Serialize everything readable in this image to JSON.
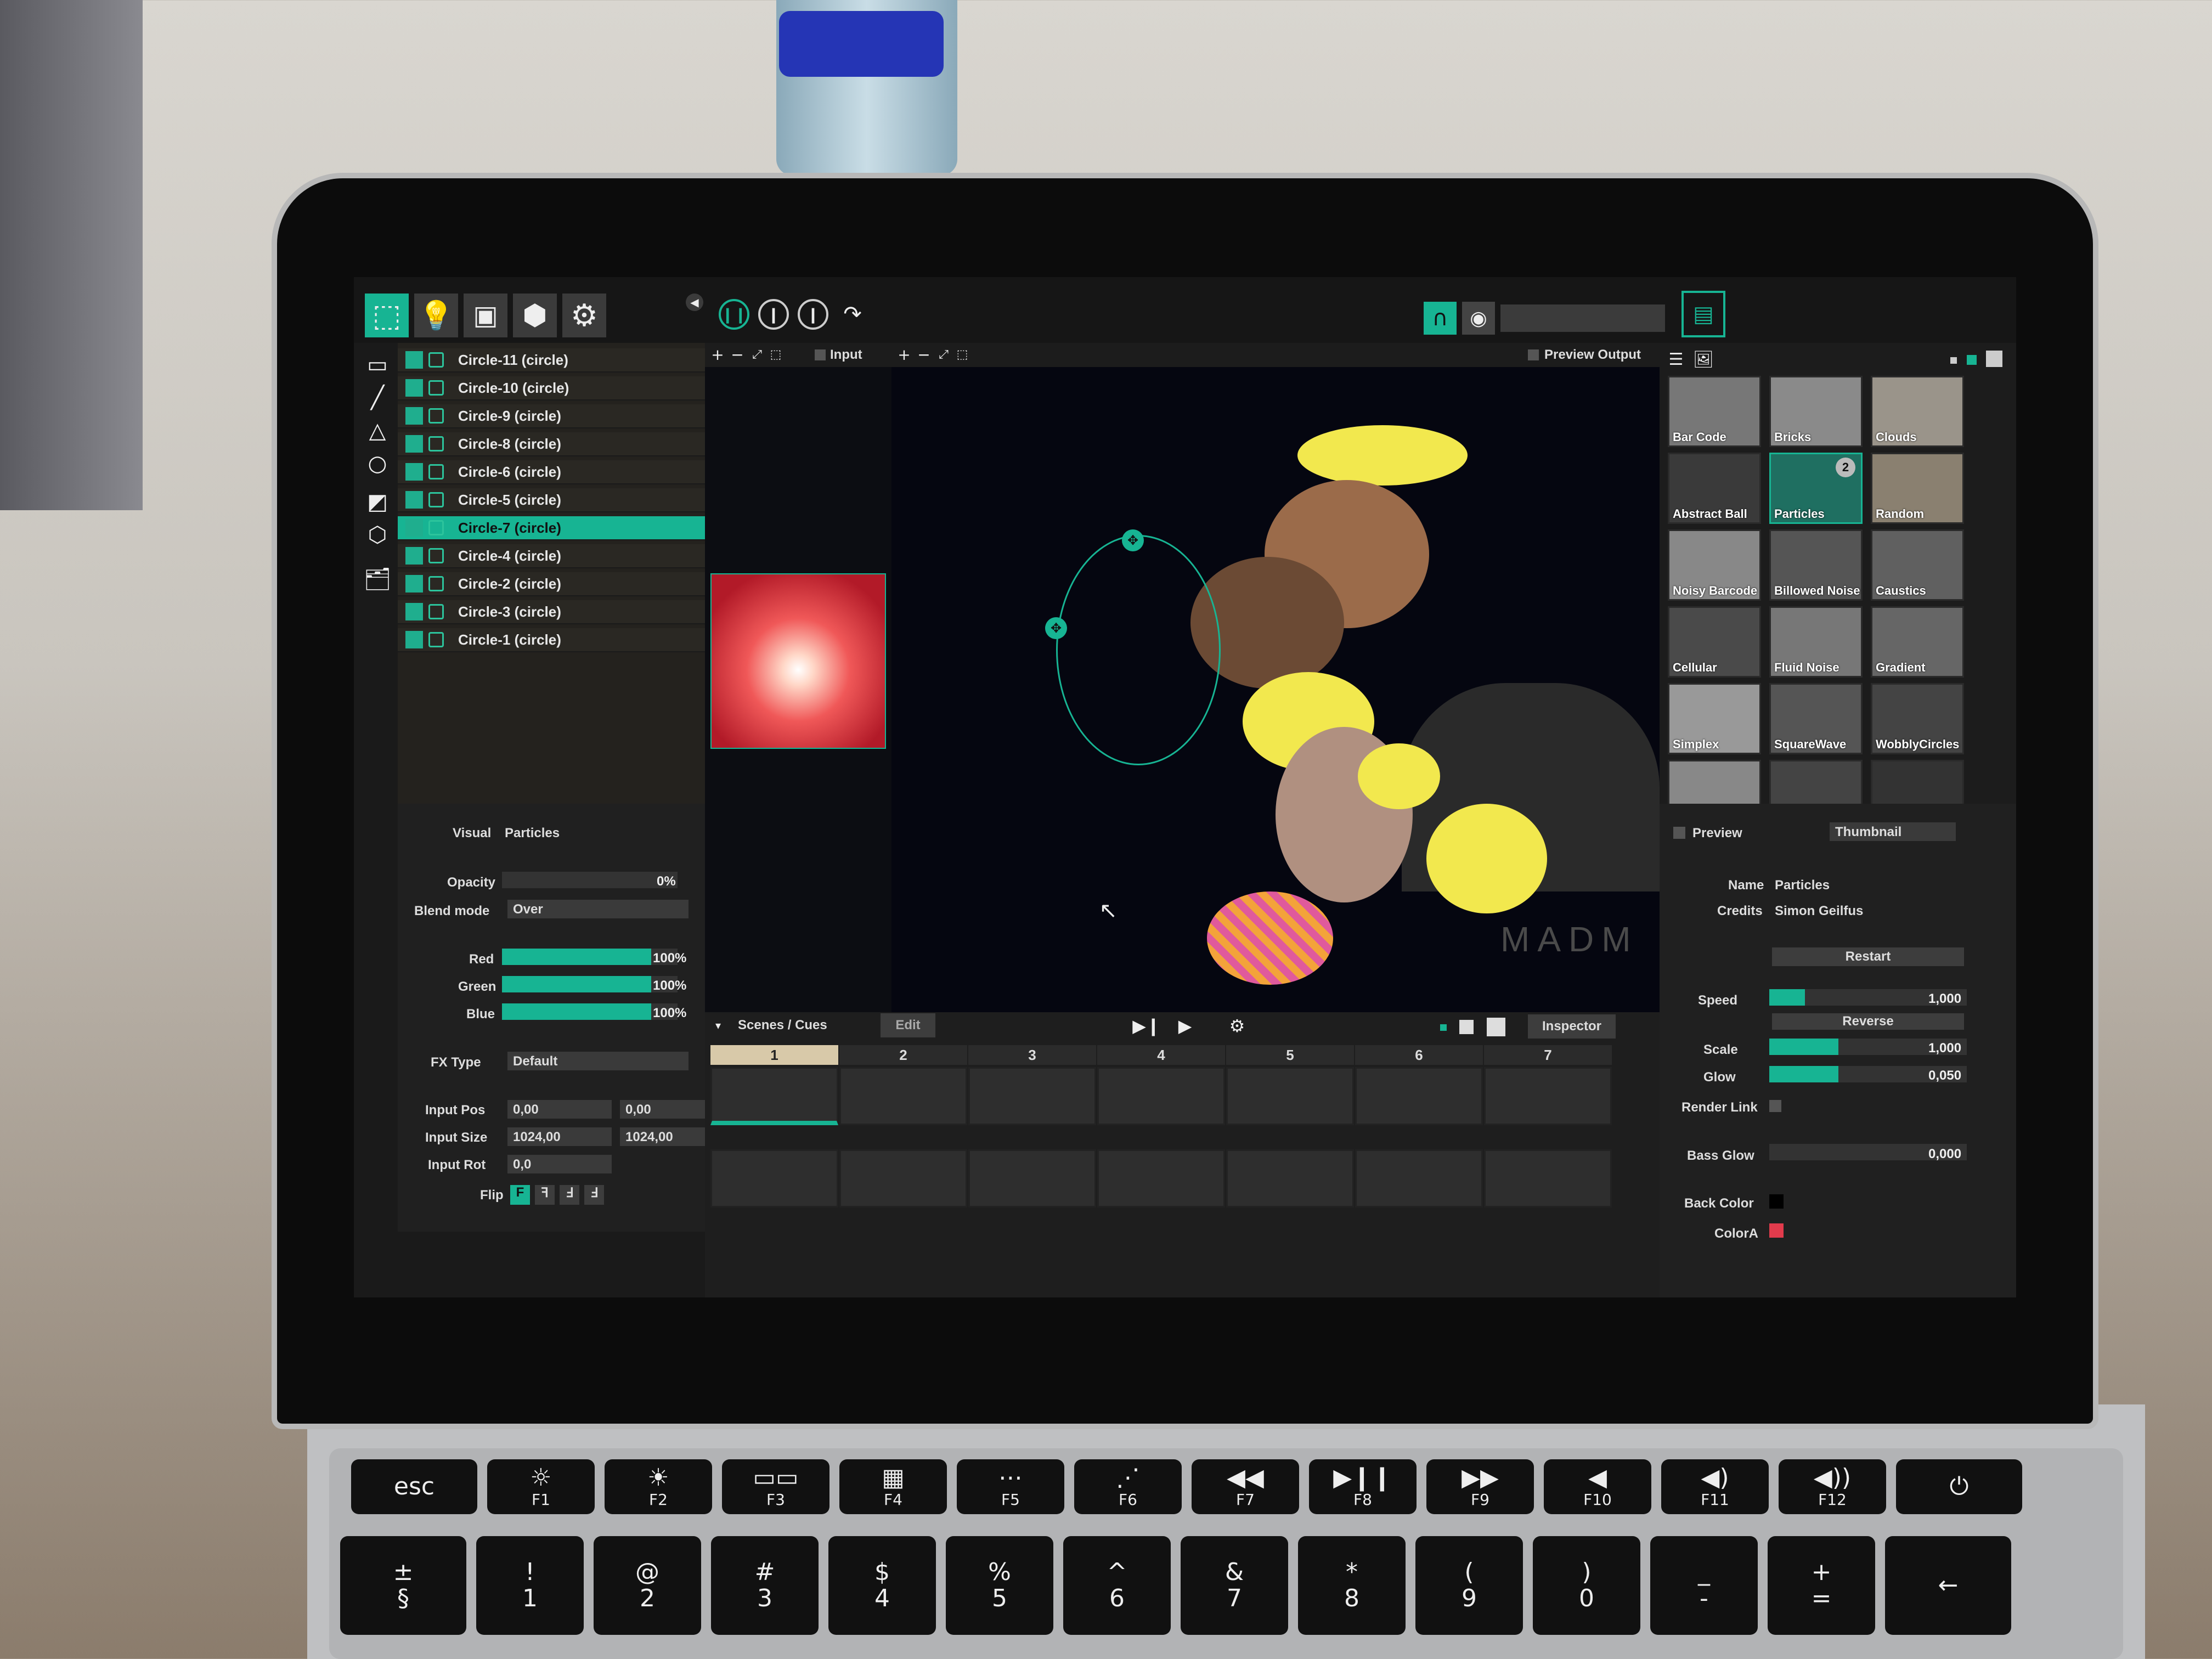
{
  "app": {
    "toolbar": {
      "mode_icons": [
        "mapping-icon",
        "lightbulb-icon",
        "projector-icon",
        "cubes-icon",
        "gear-icon"
      ],
      "transport": [
        "pause-icon",
        "step-icon",
        "step-icon",
        "redo-icon"
      ]
    },
    "layers": [
      "Circle-11 (circle)",
      "Circle-10 (circle)",
      "Circle-9 (circle)",
      "Circle-8 (circle)",
      "Circle-6 (circle)",
      "Circle-5 (circle)",
      "Circle-7 (circle)",
      "Circle-4 (circle)",
      "Circle-2 (circle)",
      "Circle-3 (circle)",
      "Circle-1 (circle)"
    ],
    "selected_layer": "Circle-7 (circle)",
    "input_view_label": "Input",
    "preview_output_label": "Preview Output",
    "canvas_watermark": "MADM",
    "properties": {
      "visual_label": "Visual",
      "visual_value": "Particles",
      "opacity_label": "Opacity",
      "opacity_value": "0%",
      "blend_label": "Blend mode",
      "blend_value": "Over",
      "red_label": "Red",
      "red_value": "100%",
      "green_label": "Green",
      "green_value": "100%",
      "blue_label": "Blue",
      "blue_value": "100%",
      "fx_label": "FX Type",
      "fx_value": "Default",
      "input_pos_label": "Input Pos",
      "input_pos_x": "0,00",
      "input_pos_y": "0,00",
      "input_size_label": "Input Size",
      "input_size_w": "1024,00",
      "input_size_h": "1024,00",
      "input_rot_label": "Input Rot",
      "input_rot_value": "0,0",
      "flip_label": "Flip",
      "flip_buttons": [
        "F",
        "ꟻ",
        "Ⅎ",
        "Ⅎ"
      ]
    },
    "scenes": {
      "title": "Scenes / Cues",
      "edit_label": "Edit",
      "inspector_label": "Inspector",
      "columns": [
        "1",
        "2",
        "3",
        "4",
        "5",
        "6",
        "7"
      ]
    },
    "library": {
      "items": [
        "Bar Code",
        "Bricks",
        "Clouds",
        "Abstract Ball",
        "Particles",
        "Random",
        "Noisy Barcode",
        "Billowed Noise",
        "Caustics",
        "Cellular",
        "Fluid Noise",
        "Gradient",
        "Simplex",
        "SquareWave",
        "WobblyCircles",
        "",
        "",
        ""
      ],
      "badge": "2"
    },
    "inspector": {
      "preview_label": "Preview",
      "thumbnail_label": "Thumbnail",
      "name_label": "Name",
      "name_value": "Particles",
      "credits_label": "Credits",
      "credits_value": "Simon Geilfus",
      "restart_label": "Restart",
      "speed_label": "Speed",
      "speed_value": "1,000",
      "reverse_label": "Reverse",
      "scale_label": "Scale",
      "scale_value": "1,000",
      "glow_label": "Glow",
      "glow_value": "0,050",
      "render_link_label": "Render Link",
      "bass_glow_label": "Bass Glow",
      "bass_glow_value": "0,000",
      "back_color_label": "Back Color",
      "color_a_label": "ColorA",
      "color_a": "#e23b4c"
    },
    "accent_color": "#17b493"
  },
  "keyboard": {
    "fn_row": [
      {
        "top": "esc",
        "bottom": ""
      },
      {
        "top": "☼",
        "bottom": "F1"
      },
      {
        "top": "☀",
        "bottom": "F2"
      },
      {
        "top": "▭▭",
        "bottom": "F3"
      },
      {
        "top": "▦",
        "bottom": "F4"
      },
      {
        "top": "⋯",
        "bottom": "F5"
      },
      {
        "top": "⋰",
        "bottom": "F6"
      },
      {
        "top": "◀◀",
        "bottom": "F7"
      },
      {
        "top": "▶❙❙",
        "bottom": "F8"
      },
      {
        "top": "▶▶",
        "bottom": "F9"
      },
      {
        "top": "◀",
        "bottom": "F10"
      },
      {
        "top": "◀)",
        "bottom": "F11"
      },
      {
        "top": "◀))",
        "bottom": "F12"
      },
      {
        "top": "⏻",
        "bottom": ""
      }
    ],
    "num_row": [
      {
        "top": "±",
        "bottom": "§"
      },
      {
        "top": "!",
        "bottom": "1"
      },
      {
        "top": "@",
        "bottom": "2"
      },
      {
        "top": "#",
        "bottom": "3"
      },
      {
        "top": "$",
        "bottom": "4"
      },
      {
        "top": "%",
        "bottom": "5"
      },
      {
        "top": "^",
        "bottom": "6"
      },
      {
        "top": "&",
        "bottom": "7"
      },
      {
        "top": "*",
        "bottom": "8"
      },
      {
        "top": "(",
        "bottom": "9"
      },
      {
        "top": ")",
        "bottom": "0"
      },
      {
        "top": "_",
        "bottom": "-"
      },
      {
        "top": "+",
        "bottom": "="
      },
      {
        "top": "←",
        "bottom": ""
      }
    ]
  }
}
